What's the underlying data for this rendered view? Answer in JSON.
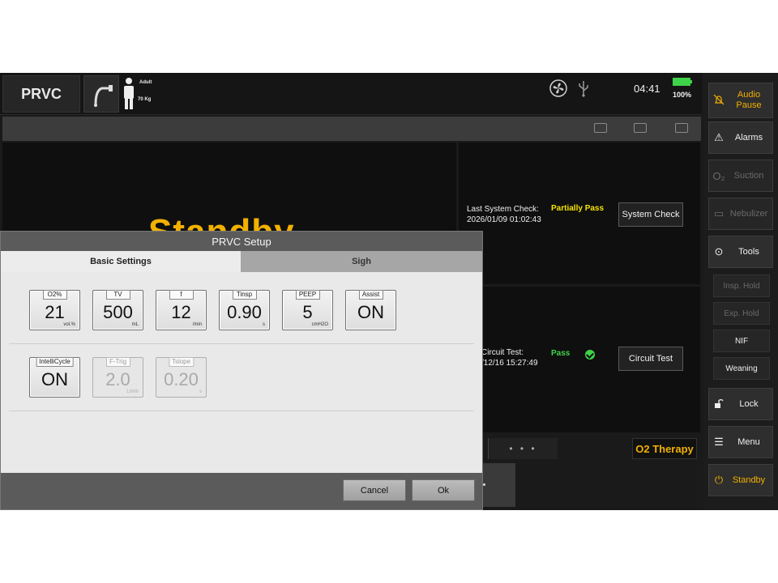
{
  "topbar": {
    "mode": "PRVC",
    "patient_type": "Adult",
    "patient_weight": "70 Kg",
    "clock": "04:41",
    "battery_pct": "100%",
    "battery_level": 1.0
  },
  "main": {
    "standby_text": "Standby",
    "last_check_label": "Last System Check:",
    "last_check_date": "2026/01/09 01:02:43",
    "last_check_status": "Partially Pass",
    "system_check_button": "System Check",
    "circuit_label": "Circuit Test:",
    "circuit_date": "/12/16 15:27:49",
    "circuit_status": "Pass",
    "circuit_test_button": "Circuit Test",
    "dots": "• • •",
    "o2_therapy": "O2 Therapy"
  },
  "sidebar": {
    "audio_pause_1": "Audio",
    "audio_pause_2": "Pause",
    "alarms": "Alarms",
    "suction": "Suction",
    "nebulizer": "Nebulizer",
    "tools": "Tools",
    "insp_hold": "Insp. Hold",
    "exp_hold": "Exp. Hold",
    "nif": "NIF",
    "weaning": "Weaning",
    "lock": "Lock",
    "menu": "Menu",
    "standby": "Standby"
  },
  "dialog": {
    "title": "PRVC Setup",
    "tabs": [
      "Basic Settings",
      "Sigh"
    ],
    "params_row1": [
      {
        "name": "O2%",
        "value": "21",
        "unit": "vol.%"
      },
      {
        "name": "TV",
        "value": "500",
        "unit": "mL"
      },
      {
        "name": "f",
        "value": "12",
        "unit": "/min"
      },
      {
        "name": "Tinsp",
        "value": "0.90",
        "unit": "s"
      },
      {
        "name": "PEEP",
        "value": "5",
        "unit": "cmH2O"
      },
      {
        "name": "Assist",
        "value": "ON",
        "unit": ""
      }
    ],
    "params_row2": [
      {
        "name": "IntelliCycle",
        "value": "ON",
        "unit": ""
      },
      {
        "name": "F-Trig",
        "value": "2.0",
        "unit": "L/min"
      },
      {
        "name": "Tslope",
        "value": "0.20",
        "unit": "s"
      }
    ],
    "cancel": "Cancel",
    "ok": "Ok"
  },
  "colors": {
    "accent": "#f2b000",
    "pass": "#3fd34a",
    "partial": "#f5e300"
  }
}
